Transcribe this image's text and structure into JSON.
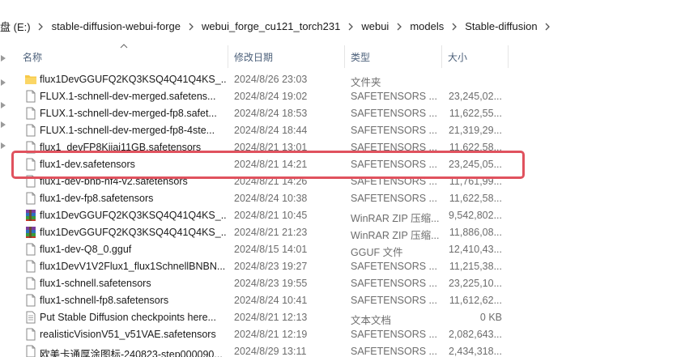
{
  "breadcrumb": {
    "items": [
      "盘 (E:)",
      "stable-diffusion-webui-forge",
      "webui_forge_cu121_torch231",
      "webui",
      "models",
      "Stable-diffusion"
    ]
  },
  "columns": {
    "name": "名称",
    "date": "修改日期",
    "type": "类型",
    "size": "大小"
  },
  "files": [
    {
      "name": "flux1DevGGUFQ2KQ3KSQ4Q41Q4KS_...",
      "date": "2024/8/26 23:03",
      "type": "文件夹",
      "size": "",
      "icon": "folder-icon"
    },
    {
      "name": "FLUX.1-schnell-dev-merged.safetens...",
      "date": "2024/8/24 19:02",
      "type": "SAFETENSORS ...",
      "size": "23,245,02...",
      "icon": "file-icon"
    },
    {
      "name": "FLUX.1-schnell-dev-merged-fp8.safet...",
      "date": "2024/8/24 18:53",
      "type": "SAFETENSORS ...",
      "size": "11,622,55...",
      "icon": "file-icon"
    },
    {
      "name": "FLUX.1-schnell-dev-merged-fp8-4ste...",
      "date": "2024/8/24 18:44",
      "type": "SAFETENSORS ...",
      "size": "21,319,29...",
      "icon": "file-icon"
    },
    {
      "name": "flux1_devFP8Kijai11GB.safetensors",
      "date": "2024/8/21 13:01",
      "type": "SAFETENSORS ...",
      "size": "11,622,58...",
      "icon": "file-icon"
    },
    {
      "name": "flux1-dev.safetensors",
      "date": "2024/8/21 14:21",
      "type": "SAFETENSORS ...",
      "size": "23,245,05...",
      "icon": "file-icon"
    },
    {
      "name": "flux1-dev-bnb-nf4-v2.safetensors",
      "date": "2024/8/21 14:26",
      "type": "SAFETENSORS ...",
      "size": "11,761,99...",
      "icon": "file-icon"
    },
    {
      "name": "flux1-dev-fp8.safetensors",
      "date": "2024/8/24 10:38",
      "type": "SAFETENSORS ...",
      "size": "11,622,58...",
      "icon": "file-icon"
    },
    {
      "name": "flux1DevGGUFQ2KQ3KSQ4Q41Q4KS_...",
      "date": "2024/8/21 10:45",
      "type": "WinRAR ZIP 压缩...",
      "size": "9,542,802...",
      "icon": "winrar-icon"
    },
    {
      "name": "flux1DevGGUFQ2KQ3KSQ4Q41Q4KS_...",
      "date": "2024/8/21 21:23",
      "type": "WinRAR ZIP 压缩...",
      "size": "11,886,08...",
      "icon": "winrar-icon"
    },
    {
      "name": "flux1-dev-Q8_0.gguf",
      "date": "2024/8/15 14:01",
      "type": "GGUF 文件",
      "size": "12,410,43...",
      "icon": "file-icon"
    },
    {
      "name": "flux1DevV1V2Flux1_flux1SchnellBNBN...",
      "date": "2024/8/23 19:27",
      "type": "SAFETENSORS ...",
      "size": "11,215,38...",
      "icon": "file-icon"
    },
    {
      "name": "flux1-schnell.safetensors",
      "date": "2024/8/23 19:55",
      "type": "SAFETENSORS ...",
      "size": "23,225,10...",
      "icon": "file-icon"
    },
    {
      "name": "flux1-schnell-fp8.safetensors",
      "date": "2024/8/24 10:41",
      "type": "SAFETENSORS ...",
      "size": "11,612,62...",
      "icon": "file-icon"
    },
    {
      "name": "Put Stable Diffusion checkpoints here...",
      "date": "2024/8/21 12:13",
      "type": "文本文档",
      "size": "0 KB",
      "icon": "text-file-icon"
    },
    {
      "name": "realisticVisionV51_v51VAE.safetensors",
      "date": "2024/8/21 12:19",
      "type": "SAFETENSORS ...",
      "size": "2,082,643...",
      "icon": "file-icon"
    },
    {
      "name": "欧美卡通厚涂图标-240823-step000090...",
      "date": "2024/8/29 13:11",
      "type": "SAFETENSORS ...",
      "size": "2,434,318...",
      "icon": "file-icon"
    }
  ],
  "highlight_color": "#e0525e"
}
